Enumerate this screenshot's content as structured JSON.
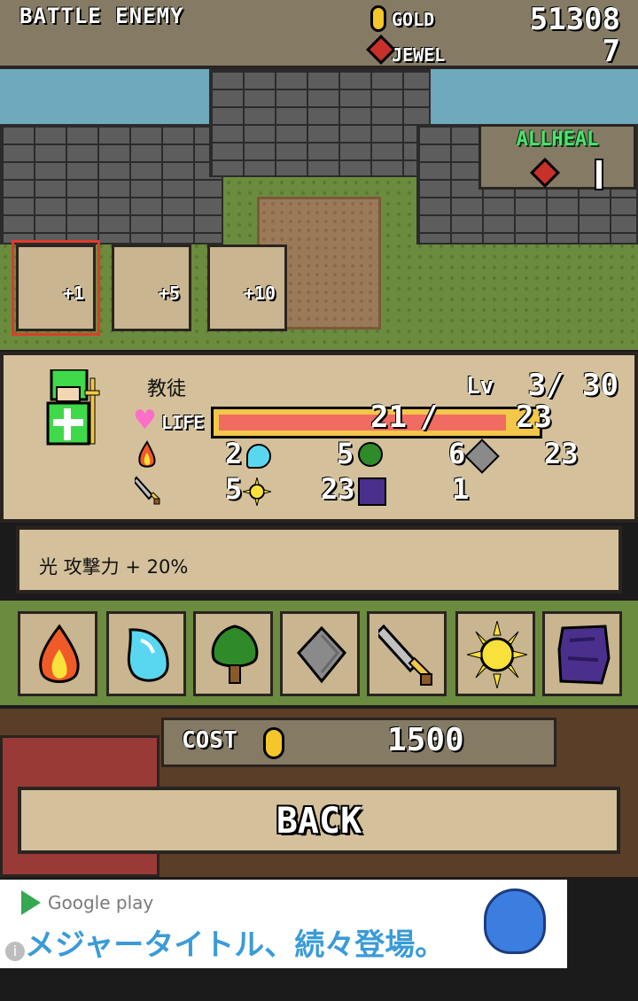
{
  "header": {
    "title": "BATTLE ENEMY",
    "gold_label": "GOLD",
    "gold_value": "51308",
    "jewel_label": "JEWEL",
    "jewel_value": "7"
  },
  "allheal": {
    "label": "ALLHEAL",
    "icon": "jewel-icon"
  },
  "upgrade_cards": [
    {
      "label": "+1",
      "selected": true
    },
    {
      "label": "+5",
      "selected": false
    },
    {
      "label": "+10",
      "selected": false
    }
  ],
  "unit": {
    "name": "教徒",
    "lv_label": "Lv",
    "lv_value": "3/ 30",
    "life_label": "LIFE",
    "life_current": "21",
    "life_separator": "/",
    "life_max": "23",
    "life_fraction": 0.91,
    "stats_row1": [
      {
        "icon": "fire-icon",
        "value": "2",
        "color": "#f05a28"
      },
      {
        "icon": "water-icon",
        "value": "5",
        "color": "#5ad7f0"
      },
      {
        "icon": "tree-icon",
        "value": "6",
        "color": "#2f8a2a"
      },
      {
        "icon": "stone-icon",
        "value": "23",
        "color": "#8a8a8a"
      }
    ],
    "stats_row2": [
      {
        "icon": "sword-icon",
        "value": "5",
        "color": "#c0c0c0"
      },
      {
        "icon": "light-icon",
        "value": "23",
        "color": "#f7e13a"
      },
      {
        "icon": "dark-icon",
        "value": "1",
        "color": "#4a2f8c"
      }
    ]
  },
  "description": "光 攻撃力 + 20%",
  "elements": [
    {
      "name": "fire",
      "icon": "fire-icon",
      "color": "#f05a28"
    },
    {
      "name": "water",
      "icon": "water-icon",
      "color": "#5ad7f0"
    },
    {
      "name": "tree",
      "icon": "tree-icon",
      "color": "#2f8a2a"
    },
    {
      "name": "stone",
      "icon": "stone-icon",
      "color": "#8a8a8a"
    },
    {
      "name": "sword",
      "icon": "sword-icon",
      "color": "#c0c0c0"
    },
    {
      "name": "light",
      "icon": "light-icon",
      "color": "#f7e13a"
    },
    {
      "name": "dark",
      "icon": "dark-icon",
      "color": "#4a2f8c"
    }
  ],
  "cost": {
    "label": "COST",
    "value": "1500"
  },
  "back_label": "BACK",
  "ad": {
    "brand": "Google play",
    "text": "メジャータイトル、続々登場。",
    "info": "i"
  }
}
